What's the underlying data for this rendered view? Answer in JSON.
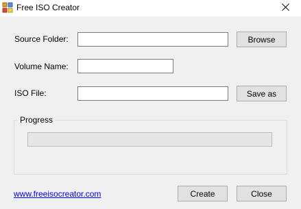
{
  "window": {
    "title": "Free ISO Creator",
    "icon": "app-icon",
    "close_icon": "close-icon"
  },
  "form": {
    "source_folder_label": "Source Folder:",
    "source_folder_value": "",
    "volume_name_label": "Volume Name:",
    "volume_name_value": "",
    "iso_file_label": "ISO File:",
    "iso_file_value": "",
    "browse_label": "Browse",
    "save_as_label": "Save as"
  },
  "progress": {
    "group_title": "Progress",
    "value": 0
  },
  "footer": {
    "website_link": "www.freeisocreator.com",
    "create_label": "Create",
    "close_label": "Close"
  },
  "colors": {
    "background": "#f0f0f0",
    "link": "#0000ff",
    "button": "#e1e1e1"
  }
}
